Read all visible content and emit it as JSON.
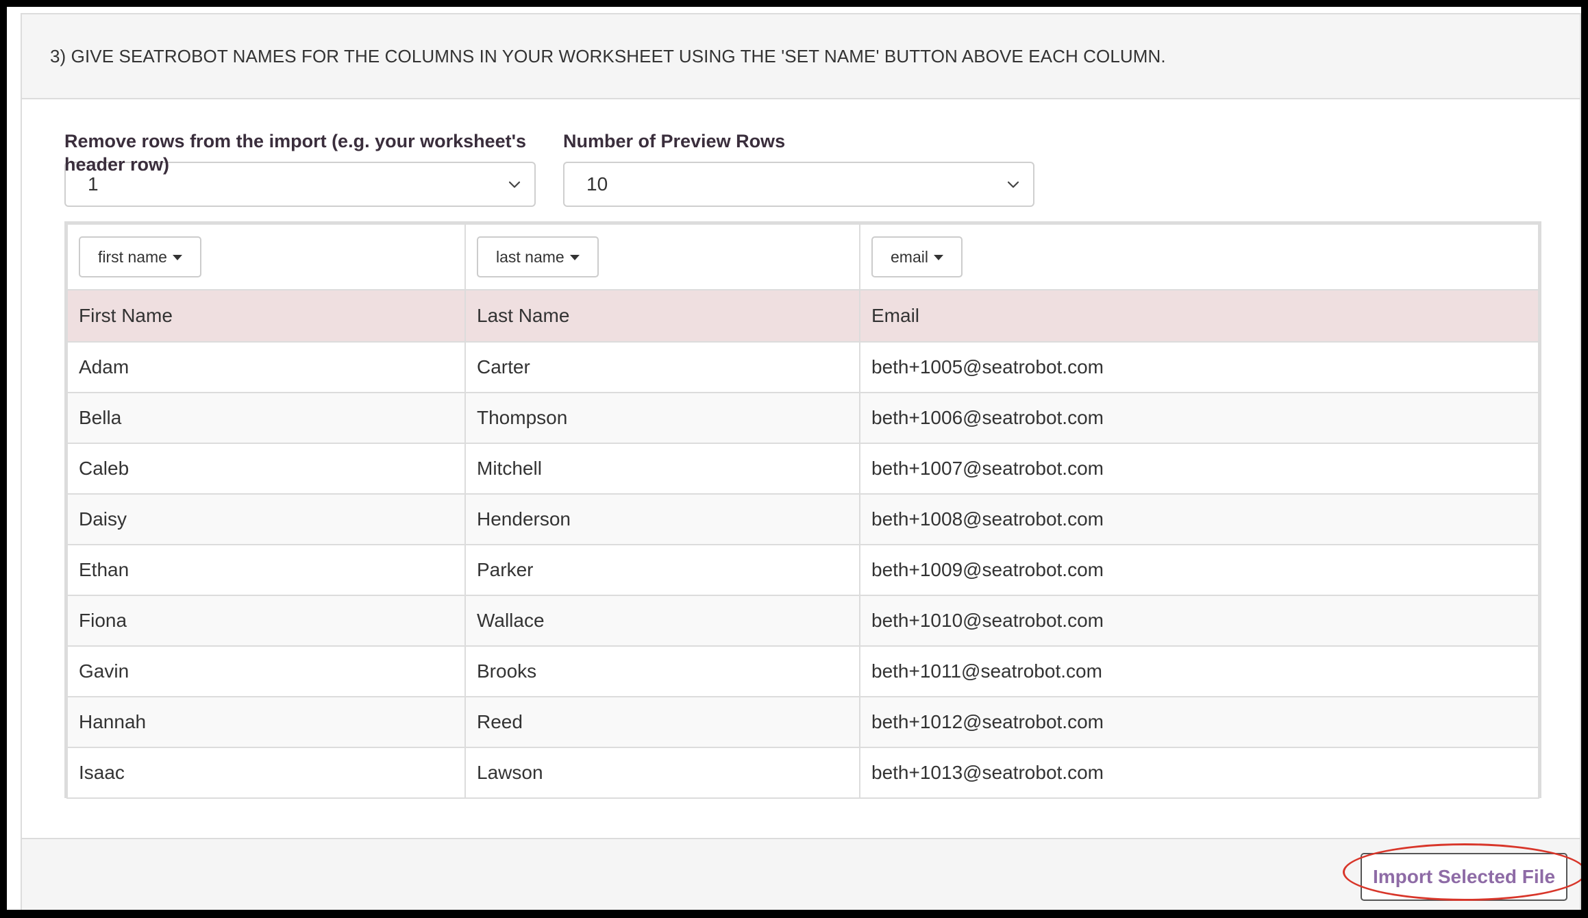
{
  "heading": "3) GIVE SEATROBOT NAMES FOR THE COLUMNS IN YOUR WORKSHEET USING THE 'SET NAME' BUTTON ABOVE EACH COLUMN.",
  "remove_rows": {
    "label": "Remove rows from the import (e.g. your worksheet's header row)",
    "value": "1"
  },
  "preview_rows": {
    "label": "Number of Preview Rows",
    "value": "10"
  },
  "set_name_buttons": [
    "first name",
    "last name",
    "email"
  ],
  "table": {
    "header": [
      "First Name",
      "Last Name",
      "Email"
    ],
    "rows": [
      [
        "Adam",
        "Carter",
        "beth+1005@seatrobot.com"
      ],
      [
        "Bella",
        "Thompson",
        "beth+1006@seatrobot.com"
      ],
      [
        "Caleb",
        "Mitchell",
        "beth+1007@seatrobot.com"
      ],
      [
        "Daisy",
        "Henderson",
        "beth+1008@seatrobot.com"
      ],
      [
        "Ethan",
        "Parker",
        "beth+1009@seatrobot.com"
      ],
      [
        "Fiona",
        "Wallace",
        "beth+1010@seatrobot.com"
      ],
      [
        "Gavin",
        "Brooks",
        "beth+1011@seatrobot.com"
      ],
      [
        "Hannah",
        "Reed",
        "beth+1012@seatrobot.com"
      ],
      [
        "Isaac",
        "Lawson",
        "beth+1013@seatrobot.com"
      ]
    ]
  },
  "import_button": "Import Selected File",
  "colors": {
    "header_row_bg": "#efdfe0",
    "import_text": "#8e6ba6",
    "annotation": "#d8362a"
  },
  "icons": {
    "select_chevron": "chevron-down-icon",
    "set_name_caret": "caret-down-icon"
  }
}
